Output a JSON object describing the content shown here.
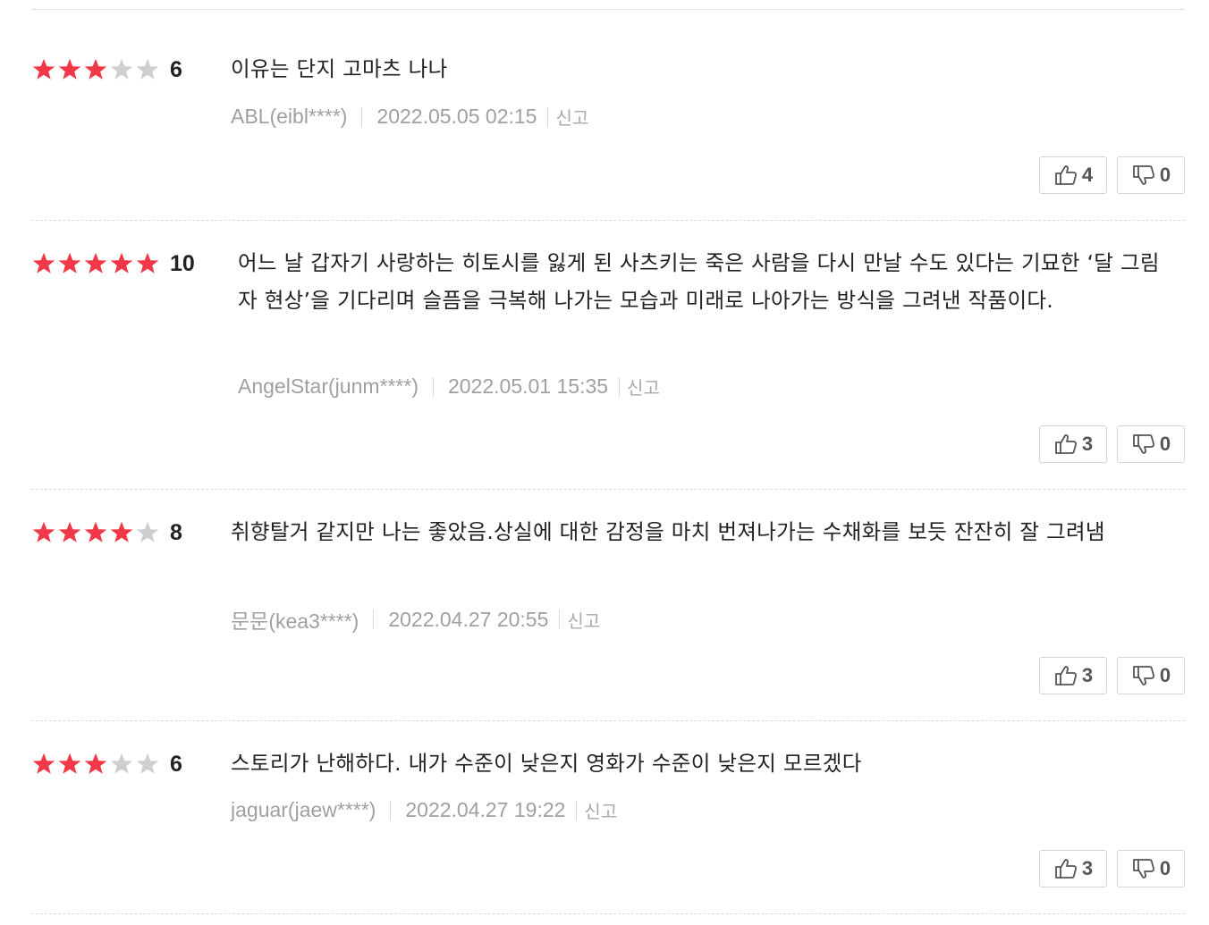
{
  "colors": {
    "star_filled": "#f03848",
    "star_empty": "#cfcfcf",
    "text": "#222222",
    "meta": "#a0a0a0"
  },
  "icons": {
    "star": "star-icon",
    "like": "thumbs-up-icon",
    "dislike": "thumbs-down-icon"
  },
  "reviews": [
    {
      "rating_stars": 3,
      "score": "6",
      "comment": "이유는 단지 고마츠 나나",
      "author": "ABL(eibl****)",
      "datetime": "2022.05.05 02:15",
      "report_label": "신고",
      "likes": "4",
      "dislikes": "0"
    },
    {
      "rating_stars": 5,
      "score": "10",
      "comment": "어느 날 갑자기 사랑하는 히토시를 잃게 된 사츠키는 죽은 사람을 다시 만날 수도 있다는 기묘한 ‘달 그림자 현상’을 기다리며 슬픔을 극복해 나가는 모습과 미래로 나아가는 방식을 그려낸 작품이다.",
      "author": "AngelStar(junm****)",
      "datetime": "2022.05.01 15:35",
      "report_label": "신고",
      "likes": "3",
      "dislikes": "0"
    },
    {
      "rating_stars": 4,
      "score": "8",
      "comment": "취향탈거 같지만 나는 좋았음.상실에 대한 감정을 마치 번져나가는 수채화를 보듯 잔잔히 잘 그려냄",
      "author": "문문(kea3****)",
      "datetime": "2022.04.27 20:55",
      "report_label": "신고",
      "likes": "3",
      "dislikes": "0"
    },
    {
      "rating_stars": 3,
      "score": "6",
      "comment": "스토리가 난해하다. 내가 수준이 낮은지 영화가 수준이 낮은지 모르겠다",
      "author": "jaguar(jaew****)",
      "datetime": "2022.04.27 19:22",
      "report_label": "신고",
      "likes": "3",
      "dislikes": "0"
    }
  ]
}
